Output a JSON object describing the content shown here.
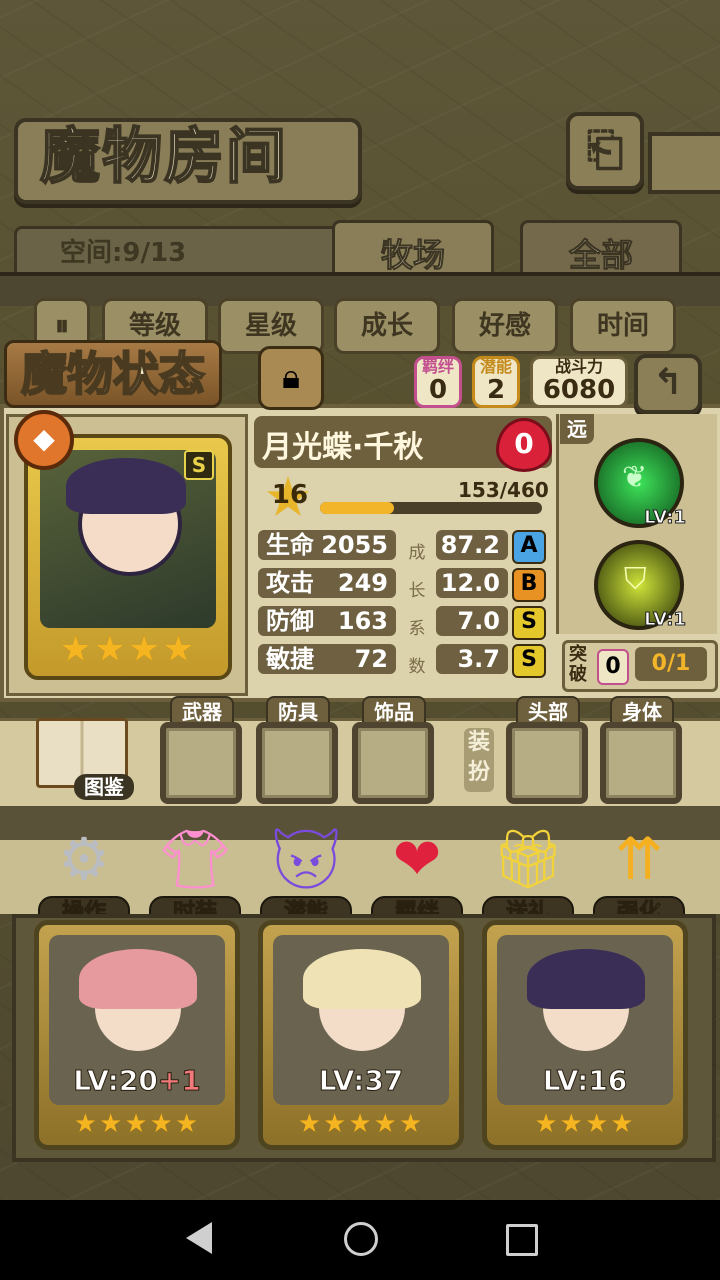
{
  "header": {
    "title": "魔物房间",
    "back_icon": "return-arrow-icon"
  },
  "space": {
    "label": "空间:9/13"
  },
  "tabs": [
    {
      "label": "牧场"
    },
    {
      "label": "全部"
    }
  ],
  "filters": [
    {
      "label": "等级"
    },
    {
      "label": "星级"
    },
    {
      "label": "成长"
    },
    {
      "label": "好感"
    },
    {
      "label": "时间"
    }
  ],
  "status": {
    "title": "魔物状态",
    "bond_label": "羁绊",
    "bond_value": "0",
    "potential_label": "潜能",
    "potential_value": "2",
    "power_label": "战斗力",
    "power_value": "6080",
    "name": "月光蝶·千秋",
    "affection": "0",
    "level": "16",
    "exp": "153/460",
    "exp_fraction": 0.333,
    "rank": "S",
    "stars": 4,
    "range_label": "远",
    "stats": [
      {
        "label": "生命",
        "value": "2055",
        "growth": "87.2",
        "grade": "A"
      },
      {
        "label": "攻击",
        "value": "249",
        "growth": "12.0",
        "grade": "B"
      },
      {
        "label": "防御",
        "value": "163",
        "growth": "7.0",
        "grade": "S"
      },
      {
        "label": "敏捷",
        "value": "72",
        "growth": "3.7",
        "grade": "S"
      }
    ],
    "growth_label": [
      "成",
      "长",
      "系",
      "数"
    ],
    "skills": [
      {
        "level": "LV:1"
      },
      {
        "level": "LV:1"
      }
    ],
    "breakthrough_label": "突破",
    "breakthrough_count": "0",
    "breakthrough_progress": "0/1"
  },
  "equipment": {
    "codex_label": "图鉴",
    "outfit_label": "装扮",
    "slots": [
      {
        "label": "武器"
      },
      {
        "label": "防具"
      },
      {
        "label": "饰品"
      },
      {
        "label": "头部"
      },
      {
        "label": "身体"
      }
    ]
  },
  "actions": [
    {
      "label": "操作",
      "icon": "gear-icon"
    },
    {
      "label": "时装",
      "icon": "outfit-icon"
    },
    {
      "label": "潜能",
      "icon": "demon-icon"
    },
    {
      "label": "羁绊",
      "icon": "hearts-icon"
    },
    {
      "label": "送礼",
      "icon": "gift-icon"
    },
    {
      "label": "强化",
      "icon": "upgrade-arrows-icon"
    }
  ],
  "cards": [
    {
      "level": "LV:20",
      "bonus": "+1",
      "stars": 5
    },
    {
      "level": "LV:37",
      "bonus": "",
      "stars": 5
    },
    {
      "level": "LV:16",
      "bonus": "",
      "stars": 4
    }
  ],
  "colors": {
    "accent": "#f2b52a",
    "panel": "#dcd2ac",
    "dark": "#3b3422"
  }
}
